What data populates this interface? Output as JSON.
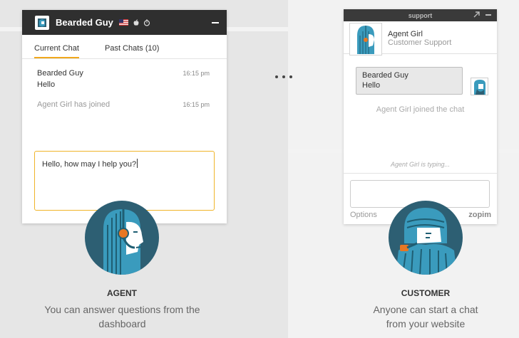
{
  "agent_window": {
    "name": "Bearded Guy",
    "tabs": [
      "Current Chat",
      "Past Chats (10)"
    ],
    "messages": [
      {
        "sender": "Bearded Guy",
        "text": "Hello",
        "time": "16:15 pm"
      },
      {
        "text": "Agent Girl has joined",
        "time": "16:15 pm"
      }
    ],
    "reply_text": "Hello, how may I help you?"
  },
  "customer_widget": {
    "bar_title": "support",
    "agent_name": "Agent Girl",
    "agent_role": "Customer Support",
    "bubble_sender": "Bearded Guy",
    "bubble_text": "Hello",
    "joined_text": "Agent Girl joined the chat",
    "typing_text": "Agent Girl is typing...",
    "options_label": "Options",
    "brand": "zopim"
  },
  "agent_label": {
    "title": "AGENT",
    "desc_line1": "You can answer questions from the",
    "desc_line2": "dashboard"
  },
  "customer_label": {
    "title": "CUSTOMER",
    "desc_line1": "Anyone can start a chat",
    "desc_line2": "from your website"
  },
  "colors": {
    "accent": "#f0a81c",
    "header_dark": "#2f2f2f",
    "avatar_bg": "#2d5f73",
    "teal_hair": "#3a9bbd",
    "orange_headset": "#e87722"
  }
}
